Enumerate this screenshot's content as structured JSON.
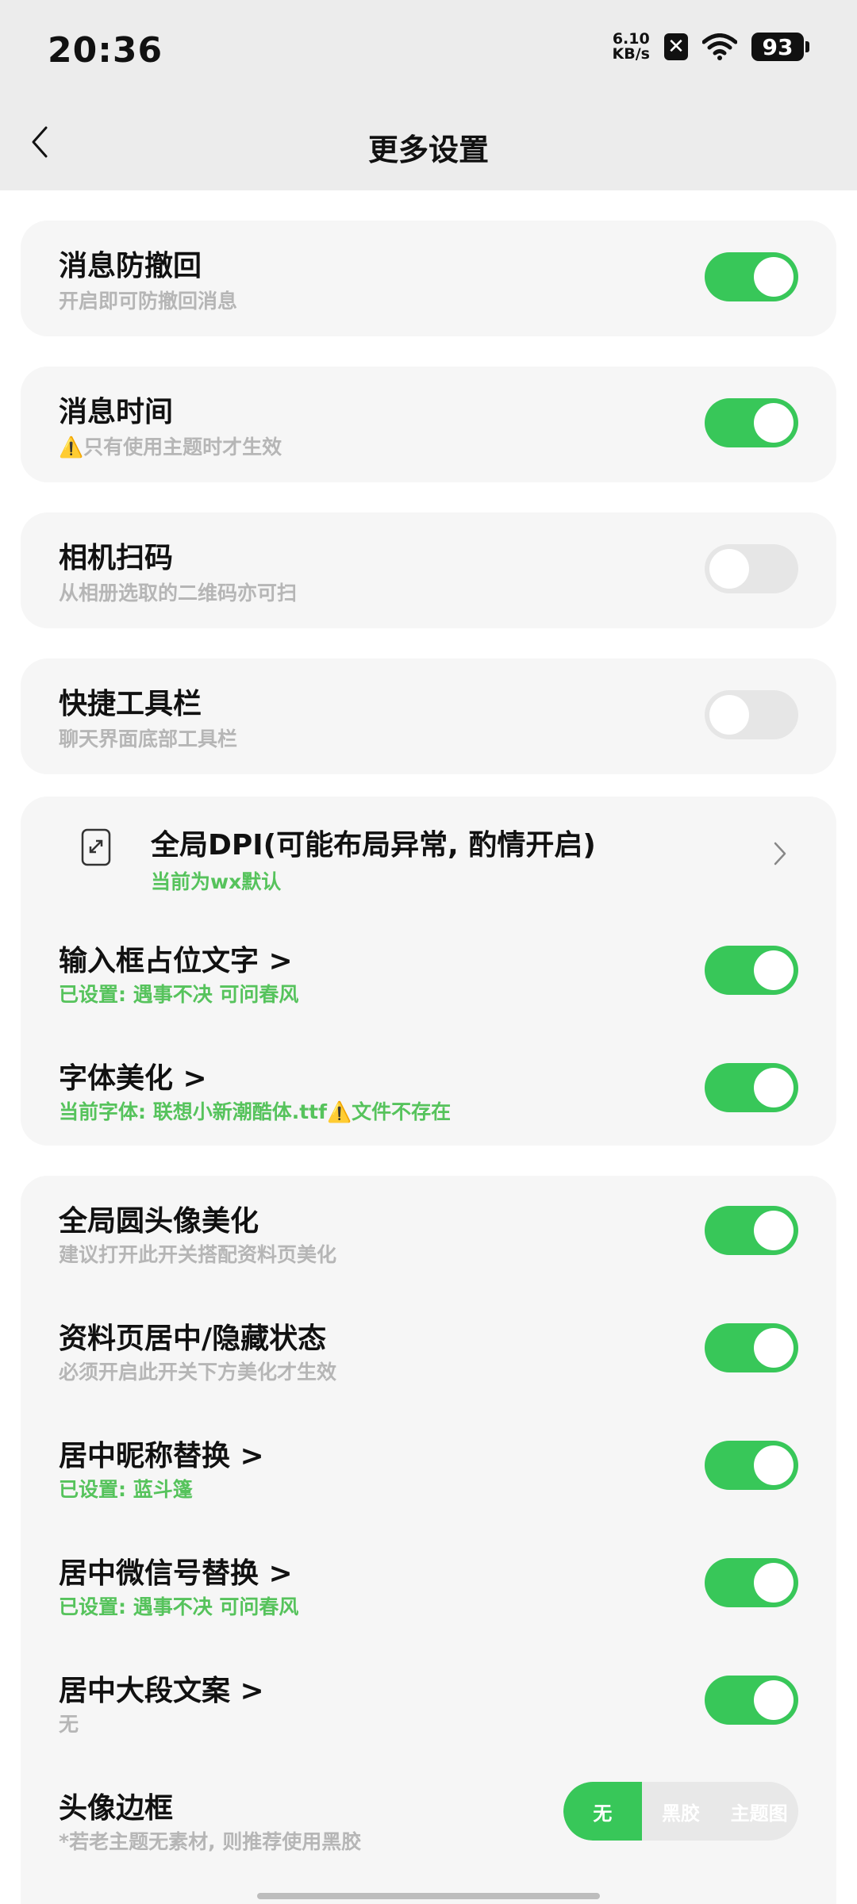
{
  "status": {
    "time": "20:36",
    "net_speed": "6.10",
    "net_unit": "KB/s",
    "battery": "93"
  },
  "header": {
    "title": "更多设置"
  },
  "settings": [
    {
      "label": "消息防撤回",
      "sub": "开启即可防撤回消息",
      "on": true
    },
    {
      "label": "消息时间",
      "sub": "⚠️只有使用主题时才生效",
      "on": true
    },
    {
      "label": "相机扫码",
      "sub": "从相册选取的二维码亦可扫",
      "on": false
    },
    {
      "label": "快捷工具栏",
      "sub": "聊天界面底部工具栏",
      "on": false
    }
  ],
  "dpi": {
    "label": "全局DPI(可能布局异常, 酌情开启)",
    "sub": "当前为wx默认"
  },
  "input_text": {
    "label": "输入框占位文字 >",
    "sub": "已设置: 遇事不决  可问春风",
    "on": true
  },
  "font": {
    "label": "字体美化 >",
    "sub": "当前字体: 联想小新潮酷体.ttf⚠️文件不存在",
    "on": true
  },
  "profile": [
    {
      "label": "全局圆头像美化",
      "sub": "建议打开此开关搭配资料页美化",
      "on": true
    },
    {
      "label": "资料页居中/隐藏状态",
      "sub": "必须开启此开关下方美化才生效",
      "on": true
    },
    {
      "label": "居中昵称替换 >",
      "sub": "已设置: 蓝斗篷",
      "on": true
    },
    {
      "label": "居中微信号替换 >",
      "sub": "已设置: 遇事不决 可问春风",
      "on": true
    },
    {
      "label": "居中大段文案 >",
      "sub": "无",
      "on": true
    }
  ],
  "avatar_frame": {
    "label": "头像边框",
    "sub": "*若老主题无素材, 则推荐使用黑胶",
    "options": [
      "无",
      "黑胶",
      "主题图"
    ]
  }
}
